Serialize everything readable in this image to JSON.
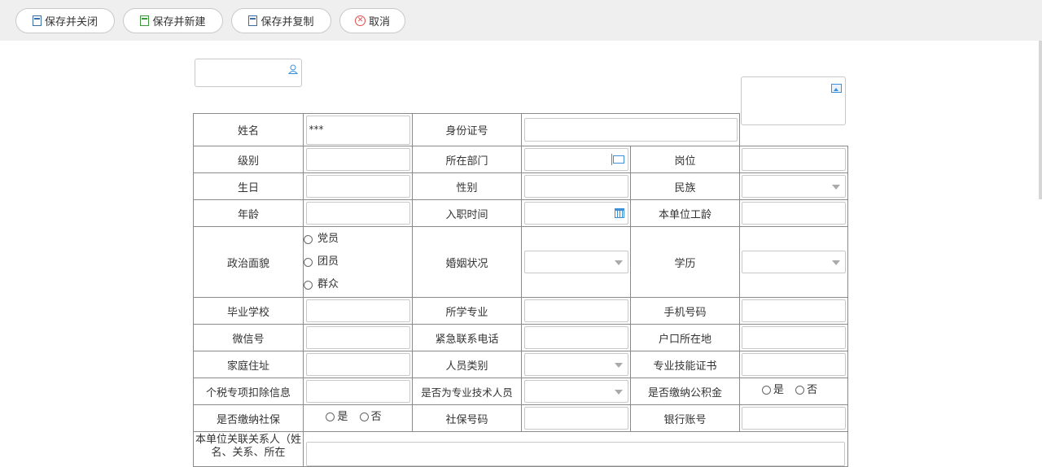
{
  "toolbar": {
    "save_close": "保存并关闭",
    "save_new": "保存并新建",
    "save_copy": "保存并复制",
    "cancel": "取消"
  },
  "form": {
    "name_label": "姓名",
    "name_value": "***",
    "id_label": "身份证号",
    "level_label": "级别",
    "dept_label": "所在部门",
    "post_label": "岗位",
    "birthday_label": "生日",
    "gender_label": "性别",
    "ethnic_label": "民族",
    "age_label": "年龄",
    "hire_date_label": "入职时间",
    "seniority_label": "本单位工龄",
    "political_label": "政治面貌",
    "political_options": [
      "党员",
      "团员",
      "群众"
    ],
    "marital_label": "婚姻状况",
    "education_label": "学历",
    "school_label": "毕业学校",
    "major_label": "所学专业",
    "phone_label": "手机号码",
    "wechat_label": "微信号",
    "emergency_label": "紧急联系电话",
    "hukou_label": "户口所在地",
    "address_label": "家庭住址",
    "staff_type_label": "人员类别",
    "cert_label": "专业技能证书",
    "tax_label": "个税专项扣除信息",
    "tech_staff_label": "是否为专业技术人员",
    "fund_label": "是否缴纳公积金",
    "social_label": "是否缴纳社保",
    "social_no_label": "社保号码",
    "bank_label": "银行账号",
    "related_label": "本单位关联关系人（姓名、关系、所在",
    "yes": "是",
    "no": "否"
  }
}
